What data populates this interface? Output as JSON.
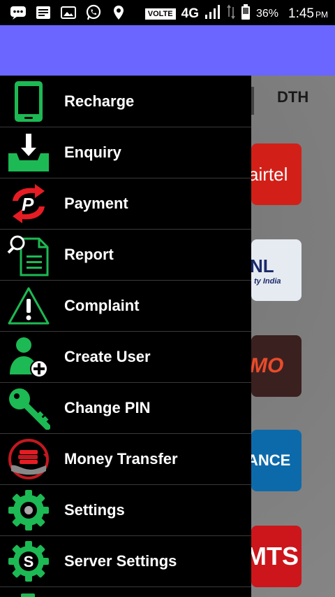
{
  "status_bar": {
    "volte": "VOLTE",
    "network": "4G",
    "battery": "36%",
    "time": "1:45",
    "ampm": "PM"
  },
  "background": {
    "tab_label": "DTH",
    "tiles": [
      {
        "label": "airtel",
        "color": "#e8201a"
      },
      {
        "label": "NL",
        "sub": "ty India",
        "color": "#e9eef5"
      },
      {
        "label": "MO",
        "color": "#3a1e1e"
      },
      {
        "label": "ANCE",
        "color": "#0f6fb0"
      },
      {
        "label": "MTS",
        "color": "#d4161c"
      }
    ]
  },
  "drawer": {
    "items": [
      {
        "label": "Recharge",
        "icon": "phone-icon"
      },
      {
        "label": "Enquiry",
        "icon": "download-tray-icon"
      },
      {
        "label": "Payment",
        "icon": "payment-arrows-icon"
      },
      {
        "label": "Report",
        "icon": "report-search-icon"
      },
      {
        "label": "Complaint",
        "icon": "warning-icon"
      },
      {
        "label": "Create User",
        "icon": "add-user-icon"
      },
      {
        "label": "Change PIN",
        "icon": "key-icon"
      },
      {
        "label": "Money Transfer",
        "icon": "money-transfer-icon"
      },
      {
        "label": "Settings",
        "icon": "gear-icon"
      },
      {
        "label": "Server Settings",
        "icon": "server-gear-icon"
      }
    ]
  }
}
